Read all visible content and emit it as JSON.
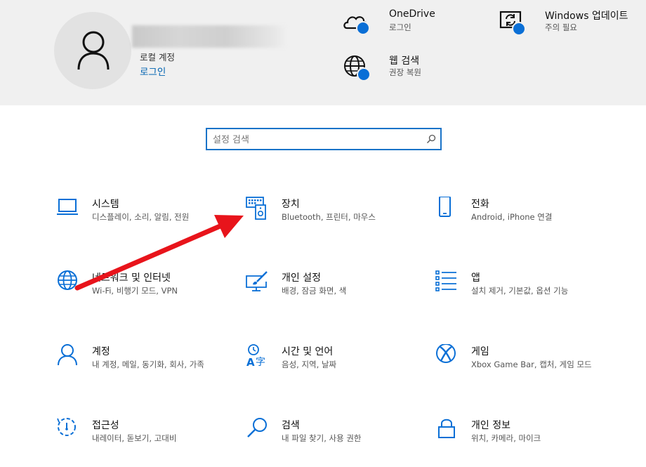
{
  "account": {
    "type": "로컬 계정",
    "signin": "로그인"
  },
  "header_items": [
    {
      "title": "OneDrive",
      "subtitle": "로그인",
      "icon": "onedrive-cloud-icon"
    },
    {
      "title": "웹 검색",
      "subtitle": "권장 복원",
      "icon": "globe-icon"
    },
    {
      "title": "Windows 업데이트",
      "subtitle": "주의 필요",
      "icon": "windows-update-icon"
    }
  ],
  "search": {
    "placeholder": "설정 검색",
    "icon": "search-icon"
  },
  "tiles": [
    {
      "title": "시스템",
      "subtitle": "디스플레이, 소리, 알림, 전원",
      "icon": "laptop-icon"
    },
    {
      "title": "장치",
      "subtitle": "Bluetooth, 프린터, 마우스",
      "icon": "keyboard-speaker-icon"
    },
    {
      "title": "전화",
      "subtitle": "Android, iPhone 연결",
      "icon": "phone-icon"
    },
    {
      "title": "네트워크 및 인터넷",
      "subtitle": "Wi-Fi, 비행기 모드, VPN",
      "icon": "globe-icon"
    },
    {
      "title": "개인 설정",
      "subtitle": "배경, 잠금 화면, 색",
      "icon": "monitor-brush-icon"
    },
    {
      "title": "앱",
      "subtitle": "설치 제거, 기본값, 옵션 기능",
      "icon": "app-list-icon"
    },
    {
      "title": "계정",
      "subtitle": "내 계정, 메일, 동기화, 회사, 가족",
      "icon": "person-icon"
    },
    {
      "title": "시간 및 언어",
      "subtitle": "음성, 지역, 날짜",
      "icon": "time-language-icon"
    },
    {
      "title": "게임",
      "subtitle": "Xbox Game Bar, 캡처, 게임 모드",
      "icon": "xbox-icon"
    },
    {
      "title": "접근성",
      "subtitle": "내레이터, 돋보기, 고대비",
      "icon": "accessibility-timer-icon"
    },
    {
      "title": "검색",
      "subtitle": "내 파일 찾기, 사용 권한",
      "icon": "search-icon"
    },
    {
      "title": "개인 정보",
      "subtitle": "위치, 카메라, 마이크",
      "icon": "lock-icon"
    }
  ],
  "colors": {
    "accent": "#0063b1",
    "icon_blue": "#0a6fd6",
    "header_bg": "#f0f0f0",
    "arrow_red": "#e8141b"
  }
}
